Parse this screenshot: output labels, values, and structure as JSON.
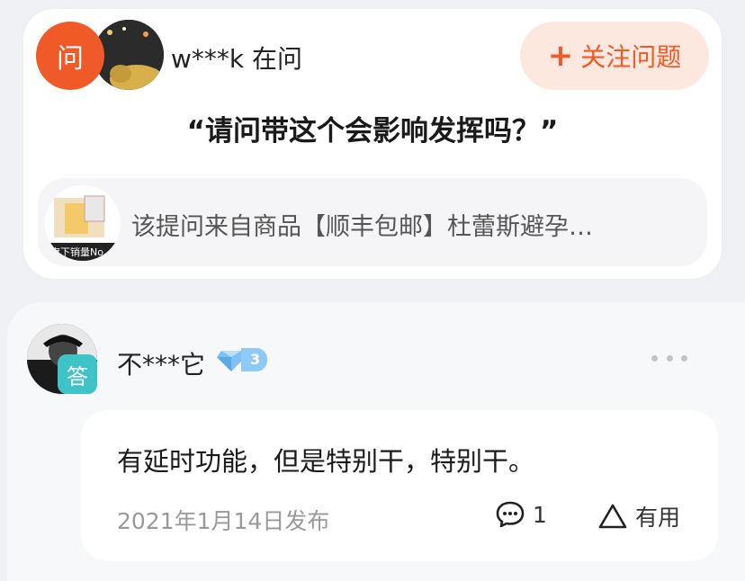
{
  "question_card": {
    "ask_badge": "问",
    "asker": "w***k 在问",
    "follow_button": "关注问题",
    "question": "“请问带这个会影响发挥吗？”",
    "source_text": "该提问来自商品【顺丰包邮】杜蕾斯避孕…",
    "source_thumb_caption": "旗下销量No."
  },
  "answer": {
    "answer_badge": "答",
    "answerer": "不***它",
    "level": "3",
    "text": "有延时功能，但是特别干，特别干。",
    "date": "2021年1月14日发布",
    "comment_count": "1",
    "useful_label": "有用"
  },
  "colors": {
    "accent": "#ef5a28",
    "follow_bg": "#fde8df",
    "answer_badge": "#3ec3c7"
  },
  "icons": {
    "follow": "plus-icon",
    "more": "more-dots-icon",
    "comment": "comment-icon",
    "useful": "thumbs-up-outline-icon",
    "level": "diamond-icon"
  }
}
